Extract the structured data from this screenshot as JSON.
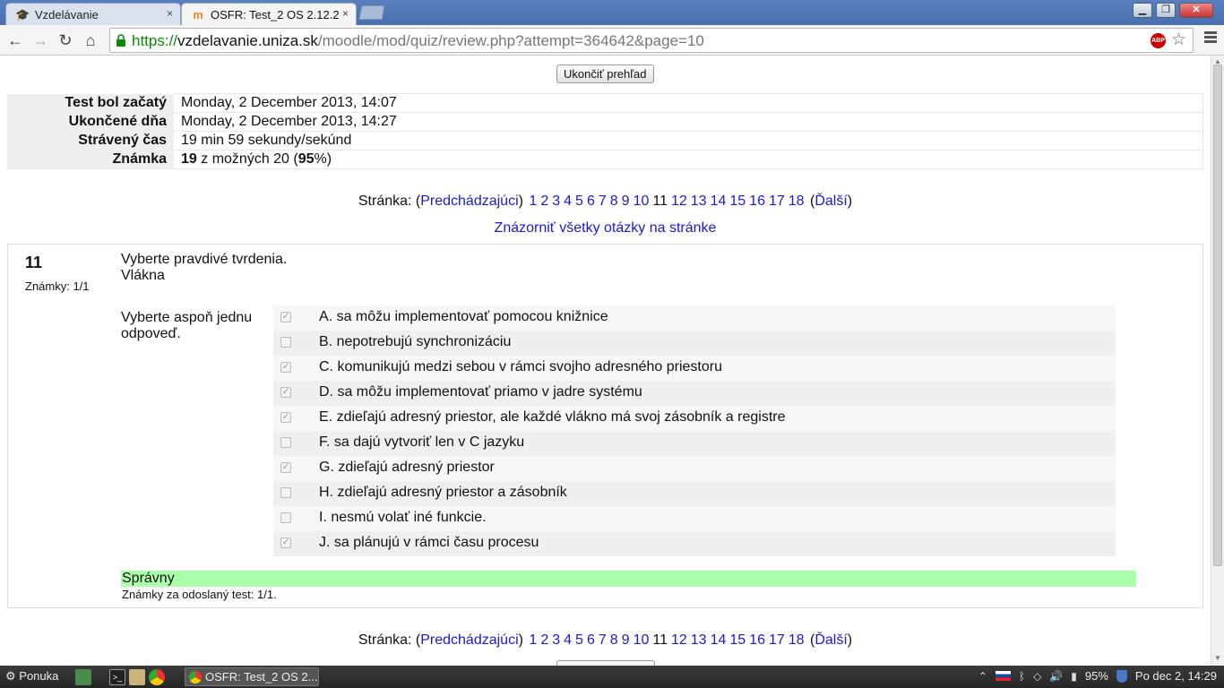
{
  "browser": {
    "tabs": [
      {
        "title": "Vzdelávanie",
        "close": "×"
      },
      {
        "title": "OSFR: Test_2 OS 2.12.2",
        "close": "×"
      }
    ],
    "url": {
      "scheme": "https://",
      "host": "vzdelavanie.uniza.sk",
      "path": "/moodle/mod/quiz/review.php?attempt=364642&page=10"
    },
    "abp_label": "ABP"
  },
  "review": {
    "finish_button": "Ukončiť prehľad",
    "summary": [
      {
        "label": "Test bol začatý",
        "value": "Monday, 2 December 2013, 14:07"
      },
      {
        "label": "Ukončené dňa",
        "value": "Monday, 2 December 2013, 14:27"
      },
      {
        "label": "Strávený čas",
        "value": "19 min 59 sekundy/sekúnd"
      }
    ],
    "grade": {
      "label": "Známka",
      "score": "19",
      "middle": " z možných 20 (",
      "percent": "95",
      "tail": "%)"
    }
  },
  "pagination": {
    "label": "Stránka: ",
    "prev": "Predchádzajúci",
    "next": "Ďalší",
    "current": "11",
    "pages_before": [
      "1",
      "2",
      "3",
      "4",
      "5",
      "6",
      "7",
      "8",
      "9",
      "10"
    ],
    "pages_after": [
      "12",
      "13",
      "14",
      "15",
      "16",
      "17",
      "18"
    ],
    "show_all": "Znázorniť všetky otázky na stránke"
  },
  "question": {
    "number": "11",
    "grade": "Známky: 1/1",
    "text_line1": "Vyberte pravdivé tvrdenia.",
    "text_line2": "Vlákna",
    "prompt": "Vyberte aspoň jednu odpoveď.",
    "answers": [
      {
        "label": "A. sa môžu implementovať pomocou knižnice",
        "checked": true
      },
      {
        "label": "B. nepotrebujú synchronizáciu",
        "checked": false
      },
      {
        "label": "C. komunikujú medzi sebou v rámci svojho adresného priestoru",
        "checked": true
      },
      {
        "label": "D. sa môžu implementovať priamo v jadre systému",
        "checked": true
      },
      {
        "label": "E. zdieľajú adresný priestor, ale každé vlákno má svoj zásobník a registre",
        "checked": true
      },
      {
        "label": "F. sa dajú vytvoriť len v C jazyku",
        "checked": false
      },
      {
        "label": "G. zdieľajú adresný priestor",
        "checked": true
      },
      {
        "label": "H. zdieľajú adresný priestor a zásobník",
        "checked": false
      },
      {
        "label": "I. nesmú volať iné funkcie.",
        "checked": false
      },
      {
        "label": "J. sa plánujú v rámci času procesu",
        "checked": true
      }
    ],
    "outcome": "Správny",
    "mark_note": "Známky za odoslaný test: 1/1."
  },
  "taskbar": {
    "menu": "Ponuka",
    "task": "OSFR: Test_2 OS 2....",
    "battery": "95%",
    "clock": "Po dec  2, 14:29"
  },
  "colors": {
    "link": "#1a1ad6",
    "correct_bg": "#aaffaa",
    "https_green": "#0a8a0a"
  }
}
